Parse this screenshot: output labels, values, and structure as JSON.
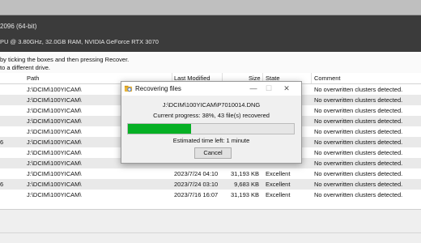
{
  "header": {
    "version_text": "2096 (64-bit)",
    "system_text": "PU @ 3.80GHz, 32.0GB RAM, NVIDIA GeForce RTX 3070"
  },
  "instructions": {
    "line1": "by ticking the boxes and then pressing Recover.",
    "line2": "to a different drive."
  },
  "table": {
    "headers": {
      "path": "Path",
      "last_modified": "Last Modified",
      "size": "Size",
      "state": "State",
      "comment": "Comment"
    },
    "rows": [
      {
        "check": "",
        "path": "J:\\DCIM\\100YICAM\\",
        "date": "",
        "size": "",
        "state": "",
        "comment": "No overwritten clusters detected."
      },
      {
        "check": "",
        "path": "J:\\DCIM\\100YICAM\\",
        "date": "",
        "size": "",
        "state": "",
        "comment": "No overwritten clusters detected."
      },
      {
        "check": "",
        "path": "J:\\DCIM\\100YICAM\\",
        "date": "",
        "size": "",
        "state": "",
        "comment": "No overwritten clusters detected."
      },
      {
        "check": "",
        "path": "J:\\DCIM\\100YICAM\\",
        "date": "",
        "size": "",
        "state": "",
        "comment": "No overwritten clusters detected."
      },
      {
        "check": "",
        "path": "J:\\DCIM\\100YICAM\\",
        "date": "",
        "size": "",
        "state": "",
        "comment": "No overwritten clusters detected."
      },
      {
        "check": "6",
        "path": "J:\\DCIM\\100YICAM\\",
        "date": "",
        "size": "",
        "state": "",
        "comment": "No overwritten clusters detected."
      },
      {
        "check": "",
        "path": "J:\\DCIM\\100YICAM\\",
        "date": "",
        "size": "",
        "state": "",
        "comment": "No overwritten clusters detected."
      },
      {
        "check": "",
        "path": "J:\\DCIM\\100YICAM\\",
        "date": "",
        "size": "",
        "state": "",
        "comment": "No overwritten clusters detected."
      },
      {
        "check": "",
        "path": "J:\\DCIM\\100YICAM\\",
        "date": "2023/7/24 04:10",
        "size": "31,193 KB",
        "state": "Excellent",
        "comment": "No overwritten clusters detected."
      },
      {
        "check": "6",
        "path": "J:\\DCIM\\100YICAM\\",
        "date": "2023/7/24 03:10",
        "size": "9,683 KB",
        "state": "Excellent",
        "comment": "No overwritten clusters detected."
      },
      {
        "check": "",
        "path": "J:\\DCIM\\100YICAM\\",
        "date": "2023/7/16 16:07",
        "size": "31,193 KB",
        "state": "Excellent",
        "comment": "No overwritten clusters detected."
      }
    ]
  },
  "dialog": {
    "title": "Recovering files",
    "file_path": "J:\\DCIM\\100YICAM\\P7010014.DNG",
    "progress_text": "Current progress: 38%, 43 file(s) recovered",
    "progress_fraction": 0.38,
    "eta_text": "Estimated time left: 1 minute",
    "cancel_label": "Cancel",
    "minimize_glyph": "—",
    "maximize_glyph": "☐",
    "close_glyph": "✕"
  },
  "colors": {
    "progress_fill": "#06b025",
    "header_bg": "#3b3b3b",
    "row_alt_bg": "#e9e9e9"
  }
}
